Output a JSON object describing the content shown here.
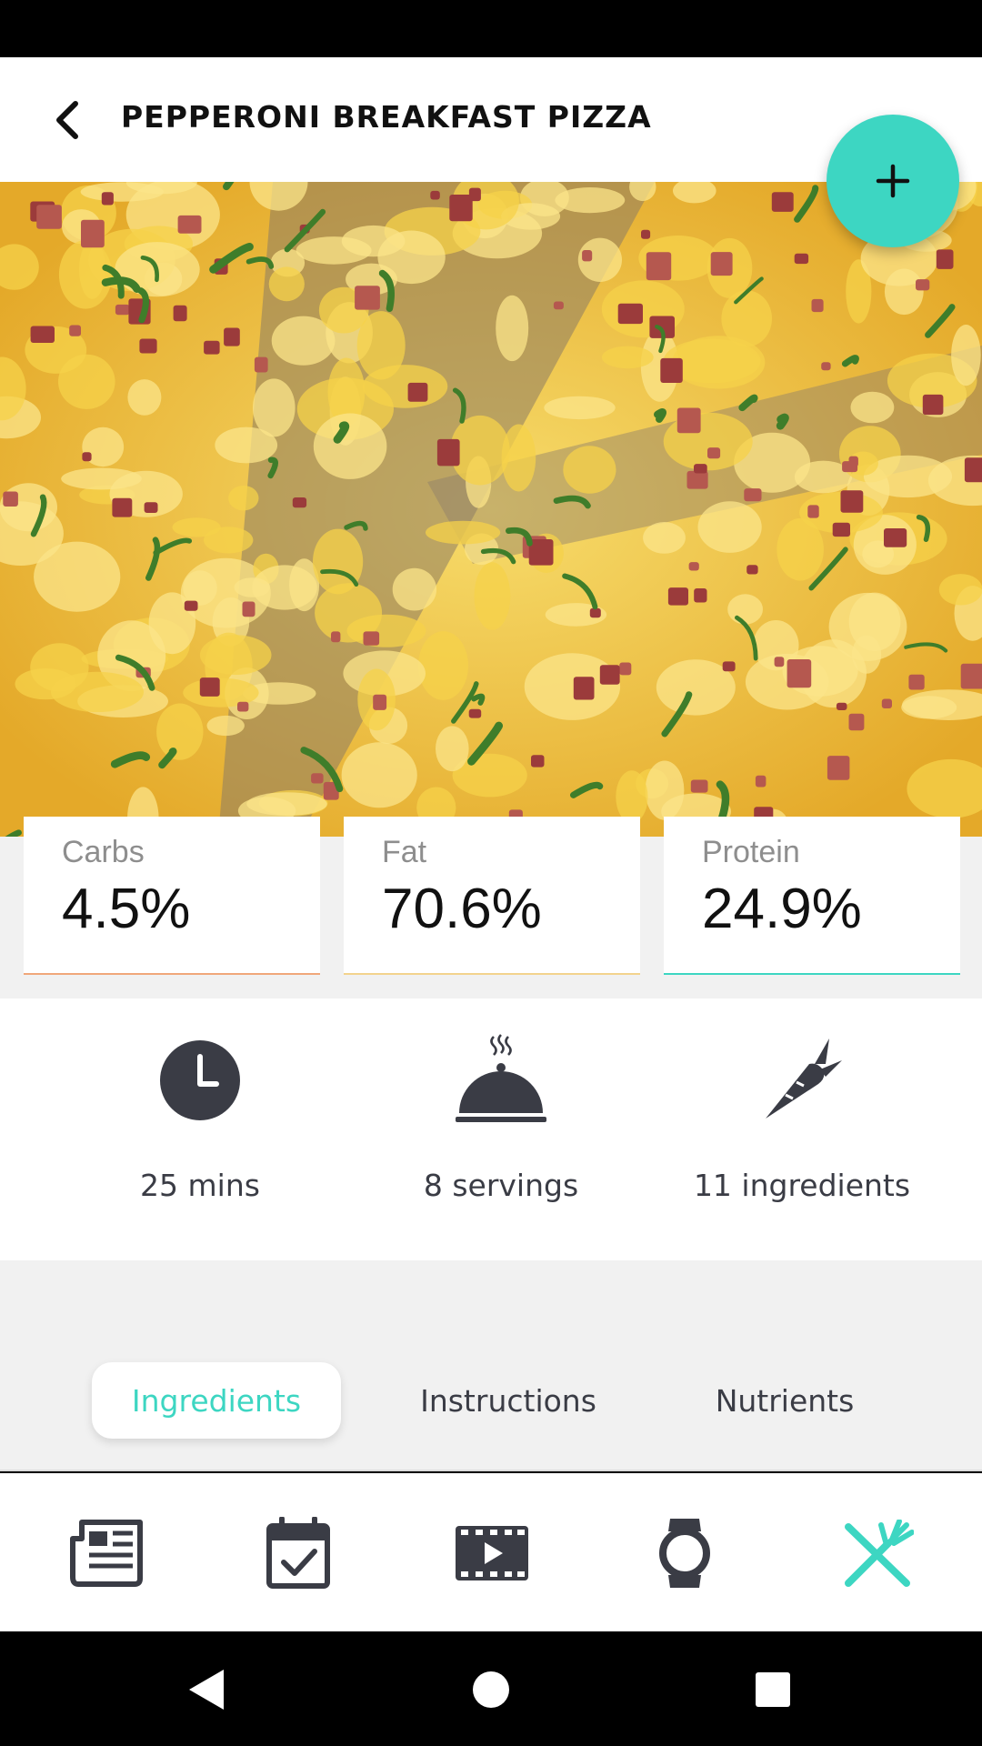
{
  "header": {
    "title": "PEPPERONI BREAKFAST PIZZA",
    "back_icon": "chevron-left-icon",
    "add_icon": "plus-icon",
    "accent_color": "#3dd6c2"
  },
  "hero": {
    "image": "pepperoni breakfast pizza photo"
  },
  "macros": [
    {
      "label": "Carbs",
      "value": "4.5%",
      "color": "#f0a77a"
    },
    {
      "label": "Fat",
      "value": "70.6%",
      "color": "#f3d38d"
    },
    {
      "label": "Protein",
      "value": "24.9%",
      "color": "#3dd6c2"
    }
  ],
  "stats": [
    {
      "icon": "clock-icon",
      "label": "25 mins"
    },
    {
      "icon": "cloche-icon",
      "label": "8 servings"
    },
    {
      "icon": "carrot-icon",
      "label": "11 ingredients"
    }
  ],
  "tabs": [
    {
      "label": "Ingredients",
      "active": true
    },
    {
      "label": "Instructions",
      "active": false
    },
    {
      "label": "Nutrients",
      "active": false
    }
  ],
  "bottom_nav": [
    {
      "icon": "newspaper-icon",
      "active": false
    },
    {
      "icon": "calendar-check-icon",
      "active": false
    },
    {
      "icon": "video-icon",
      "active": false
    },
    {
      "icon": "watch-icon",
      "active": false
    },
    {
      "icon": "utensils-icon",
      "active": true
    }
  ],
  "system_nav": [
    "back-triangle-icon",
    "home-circle-icon",
    "recents-square-icon"
  ]
}
